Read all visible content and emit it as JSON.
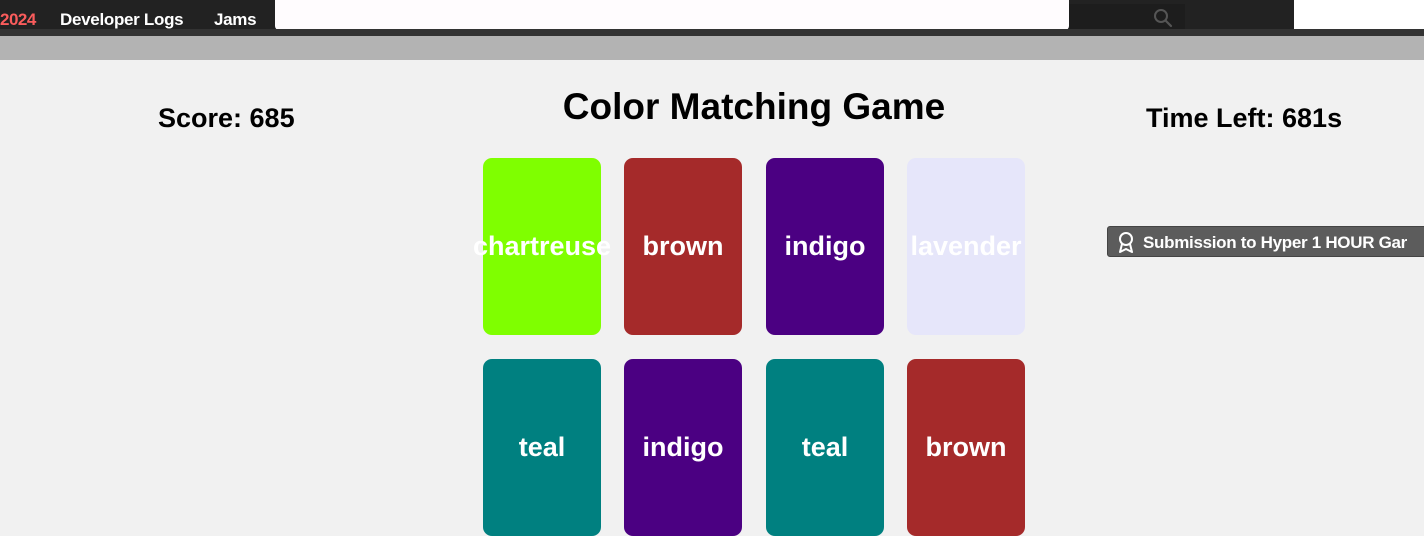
{
  "nav": {
    "year": "2024",
    "links": [
      "Developer Logs",
      "Jams"
    ],
    "search_placeholder": "",
    "search_icon": "search-icon"
  },
  "game": {
    "title": "Color Matching Game",
    "score": "Score: 685",
    "time_left": "Time Left: 681s",
    "cards": [
      {
        "label": "chartreuse",
        "color": "#7fff00"
      },
      {
        "label": "brown",
        "color": "#a52a2a"
      },
      {
        "label": "indigo",
        "color": "#4b0082"
      },
      {
        "label": "lavender",
        "color": "#e6e6fa"
      },
      {
        "label": "teal",
        "color": "#008080"
      },
      {
        "label": "indigo",
        "color": "#4b0082"
      },
      {
        "label": "teal",
        "color": "#008080"
      },
      {
        "label": "brown",
        "color": "#a52a2a"
      }
    ]
  },
  "badge": {
    "label": "Submission to Hyper 1 HOUR Gar",
    "icon": "award-ribbon-icon"
  }
}
